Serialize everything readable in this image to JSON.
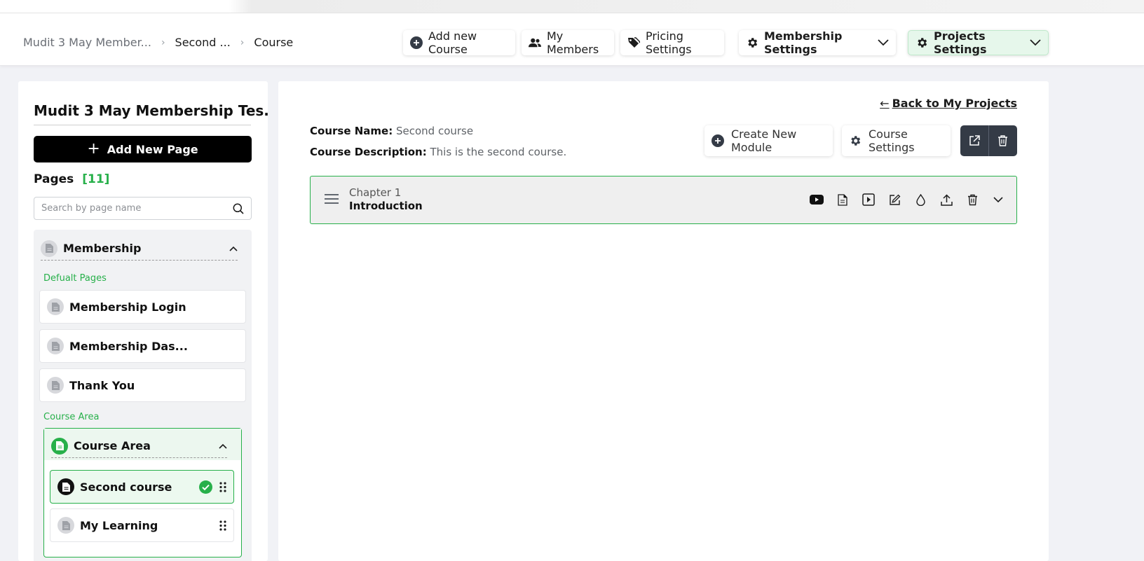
{
  "breadcrumb": {
    "items": [
      "Mudit 3 May Member...",
      "Second ...",
      "Course"
    ]
  },
  "header": {
    "add_course": "Add new Course",
    "my_members": "My Members",
    "pricing": "Pricing Settings",
    "membership_settings": "Membership Settings",
    "projects_settings": "Projects Settings"
  },
  "sidebar": {
    "project_title": "Mudit 3 May Membership Tes...",
    "add_page": "Add New Page",
    "pages_label": "Pages",
    "pages_count": "[11]",
    "search_placeholder": "Search by page name",
    "group": {
      "label": "Membership",
      "default_label": "Defualt Pages",
      "default_pages": [
        "Membership Login",
        "Membership Das...",
        "Thank You"
      ],
      "course_area_label": "Course Area",
      "course_area": {
        "label": "Course Area",
        "items": [
          "Second course",
          "My Learning"
        ]
      }
    }
  },
  "main": {
    "back": "Back to My Projects",
    "course_name_label": "Course Name:",
    "course_name": "Second course",
    "course_desc_label": "Course Description:",
    "course_desc": "This is the second course.",
    "create_module": "Create New Module",
    "course_settings": "Course Settings",
    "chapter": {
      "number": "Chapter 1",
      "title": "Introduction"
    }
  },
  "colors": {
    "accent": "#27b04a",
    "dark": "#343b46"
  }
}
